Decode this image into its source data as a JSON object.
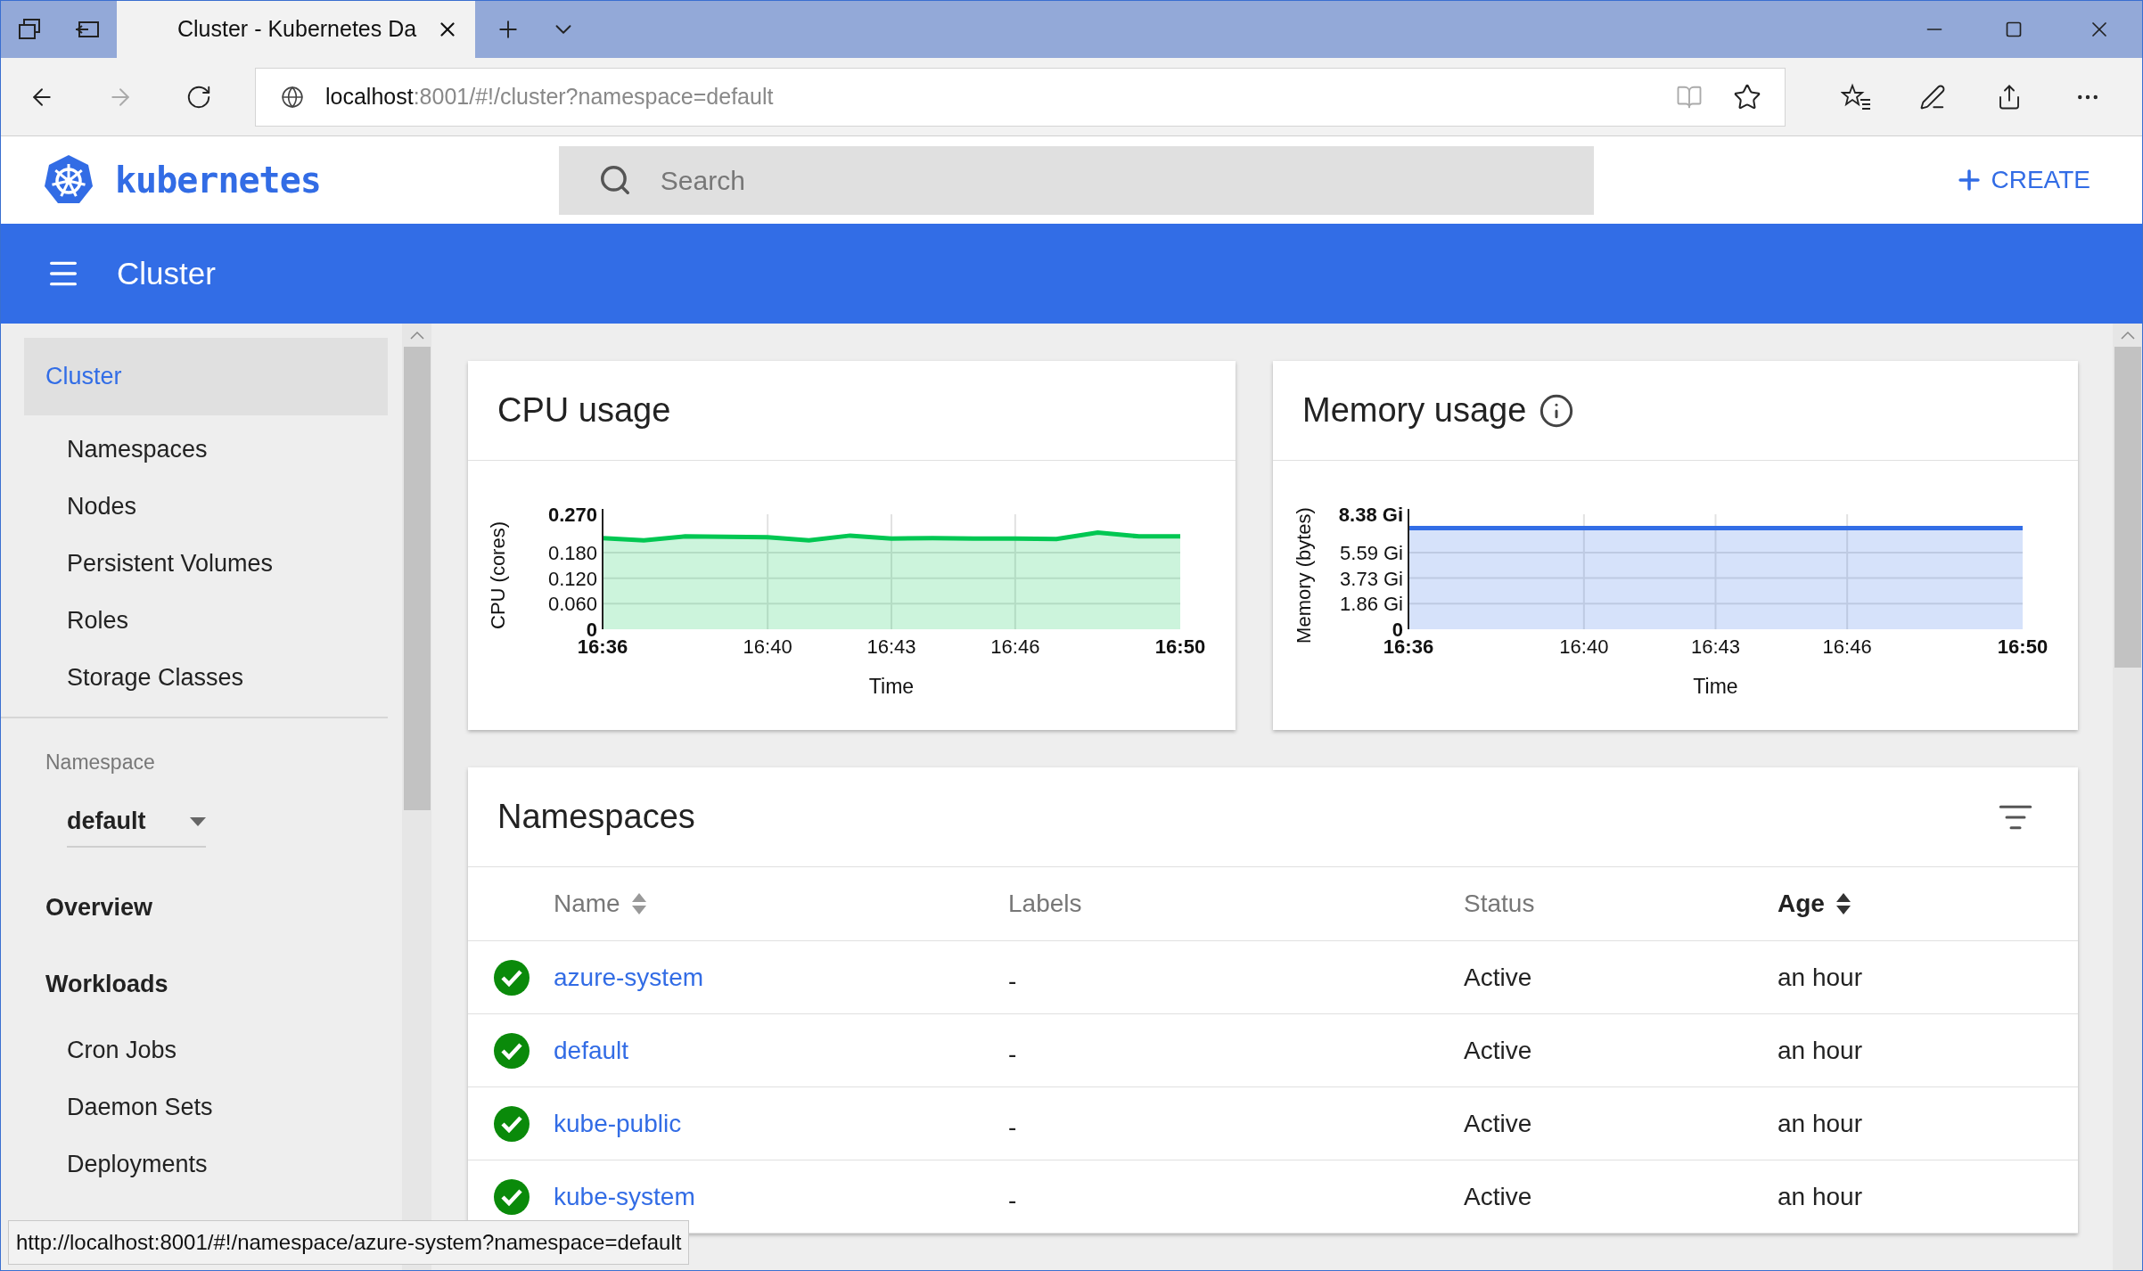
{
  "browser": {
    "tab_title": "Cluster - Kubernetes Da",
    "forward_disabled": true,
    "address_host": "localhost",
    "address_rest": ":8001/#!/cluster?namespace=default",
    "status_url": "http://localhost:8001/#!/namespace/azure-system?namespace=default"
  },
  "app_header": {
    "logo_text": "kubernetes",
    "search_placeholder": "Search",
    "create_label": "CREATE"
  },
  "toolbar": {
    "title": "Cluster"
  },
  "sidebar": {
    "top_items": [
      {
        "label": "Cluster",
        "selected": true,
        "children": [
          {
            "label": "Namespaces",
            "selected": false
          },
          {
            "label": "Nodes",
            "selected": false
          },
          {
            "label": "Persistent Volumes",
            "selected": false
          },
          {
            "label": "Roles",
            "selected": false
          },
          {
            "label": "Storage Classes",
            "selected": false
          }
        ]
      }
    ],
    "namespace": {
      "label": "Namespace",
      "value": "default"
    },
    "sections": [
      {
        "label": "Overview",
        "selected": false
      },
      {
        "label": "Workloads",
        "selected": false,
        "children": [
          {
            "label": "Cron Jobs",
            "selected": false
          },
          {
            "label": "Daemon Sets",
            "selected": false
          },
          {
            "label": "Deployments",
            "selected": false
          }
        ]
      }
    ]
  },
  "charts": [
    {
      "title": "CPU usage",
      "info_icon": false,
      "chart_data": {
        "type": "area",
        "grid": true,
        "xlabel": "Time",
        "ylabel": "CPU (cores)",
        "categories": [
          "16:36",
          null,
          null,
          null,
          "16:40",
          null,
          null,
          "16:43",
          null,
          null,
          "16:46",
          null,
          null,
          null,
          "16:50"
        ],
        "series": [
          {
            "color": "#00c752",
            "values": [
              0.214,
              0.209,
              0.218,
              0.217,
              0.216,
              0.209,
              0.22,
              0.213,
              0.214,
              0.213,
              0.213,
              0.212,
              0.227,
              0.218,
              0.218
            ]
          }
        ],
        "ylim": [
          0,
          0.27
        ],
        "yticks": [
          {
            "value": 0,
            "label": "0"
          },
          {
            "value": 0.06,
            "label": "0.060"
          },
          {
            "value": 0.12,
            "label": "0.120"
          },
          {
            "value": 0.18,
            "label": "0.180"
          },
          {
            "value": 0.27,
            "label": "0.270"
          }
        ]
      }
    },
    {
      "title": "Memory usage",
      "info_icon": true,
      "chart_data": {
        "type": "area",
        "grid": true,
        "xlabel": "Time",
        "ylabel": "Memory (bytes)",
        "categories": [
          "16:36",
          null,
          null,
          null,
          "16:40",
          null,
          null,
          "16:43",
          null,
          null,
          "16:46",
          null,
          null,
          null,
          "16:50"
        ],
        "series": [
          {
            "color": "#326de6",
            "values": [
              7.37,
              7.37,
              7.37,
              7.37,
              7.37,
              7.37,
              7.37,
              7.37,
              7.37,
              7.37,
              7.37,
              7.37,
              7.37,
              7.37,
              7.37
            ]
          }
        ],
        "ylim": [
          0,
          8.38
        ],
        "yticks": [
          {
            "value": 0,
            "label": "0"
          },
          {
            "value": 1.86,
            "label": "1.86 Gi"
          },
          {
            "value": 3.73,
            "label": "3.73 Gi"
          },
          {
            "value": 5.59,
            "label": "5.59 Gi"
          },
          {
            "value": 8.38,
            "label": "8.38 Gi"
          }
        ]
      }
    }
  ],
  "namespaces": {
    "title": "Namespaces",
    "columns": [
      {
        "label": "Name",
        "sortable": true,
        "selected": false
      },
      {
        "label": "Labels",
        "sortable": false,
        "selected": false
      },
      {
        "label": "Status",
        "sortable": false,
        "selected": false
      },
      {
        "label": "Age",
        "sortable": true,
        "selected": true
      }
    ],
    "rows": [
      {
        "name": "azure-system",
        "labels": "-",
        "status": "Active",
        "age": "an hour"
      },
      {
        "name": "default",
        "labels": "-",
        "status": "Active",
        "age": "an hour"
      },
      {
        "name": "kube-public",
        "labels": "-",
        "status": "Active",
        "age": "an hour"
      },
      {
        "name": "kube-system",
        "labels": "-",
        "status": "Active",
        "age": "an hour"
      }
    ]
  }
}
